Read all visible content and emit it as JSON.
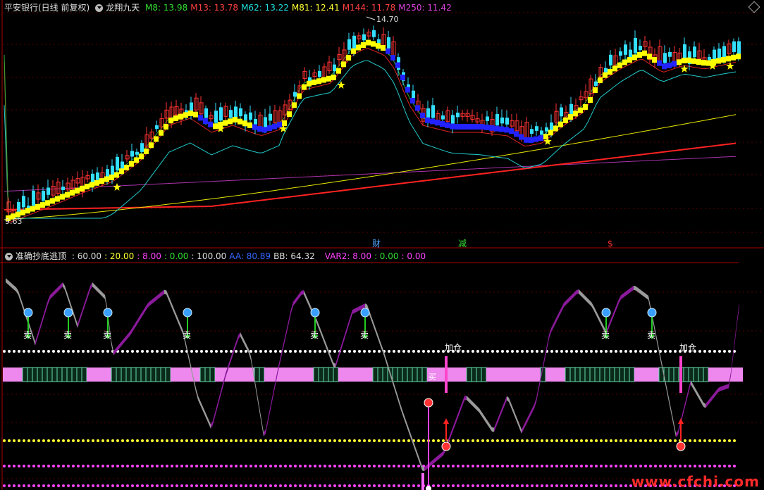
{
  "main_panel": {
    "title": "平安银行(日线 前复权)",
    "indicator": "龙翔九天",
    "ma": [
      {
        "label": "M8: 13.98",
        "color": "#33dd33"
      },
      {
        "label": "M13: 13.78",
        "color": "#ff4040"
      },
      {
        "label": "M62: 13.22",
        "color": "#22dddd"
      },
      {
        "label": "M81: 12.41",
        "color": "#ffff33"
      },
      {
        "label": "M144: 11.78",
        "color": "#ff4040"
      },
      {
        "label": "M250: 11.42",
        "color": "#dd44dd"
      }
    ],
    "high_label": "14.70",
    "low_label": "9.63",
    "events": [
      {
        "label": "财",
        "color": "#4aa3ff"
      },
      {
        "label": "减",
        "color": "#33dd33"
      },
      {
        "label": "$",
        "color": "#ff3333"
      }
    ]
  },
  "sub_panel": {
    "title": "准确抄底逃顶",
    "values": [
      {
        "label": ": 60.00",
        "color": "#dddddd"
      },
      {
        "label": ": 20.00",
        "color": "#ffff33"
      },
      {
        "label": ": 8.00",
        "color": "#ff44ff"
      },
      {
        "label": ": 0.00",
        "color": "#33dd33"
      },
      {
        "label": ": 100.00",
        "color": "#dddddd"
      },
      {
        "label": "AA: 80.89",
        "color": "#3366ff"
      },
      {
        "label": "BB: 64.32",
        "color": "#dddddd"
      },
      {
        "label": "VAR2: 8.00",
        "color": "#ff44ff"
      },
      {
        "label": ": 0.00",
        "color": "#33dd33"
      },
      {
        "label": ": 0.00",
        "color": "#ff44ff"
      }
    ],
    "sell_label": "卖",
    "add_label": "加仓",
    "buy_label": "买"
  },
  "watermark": "www.cfchi.com"
}
